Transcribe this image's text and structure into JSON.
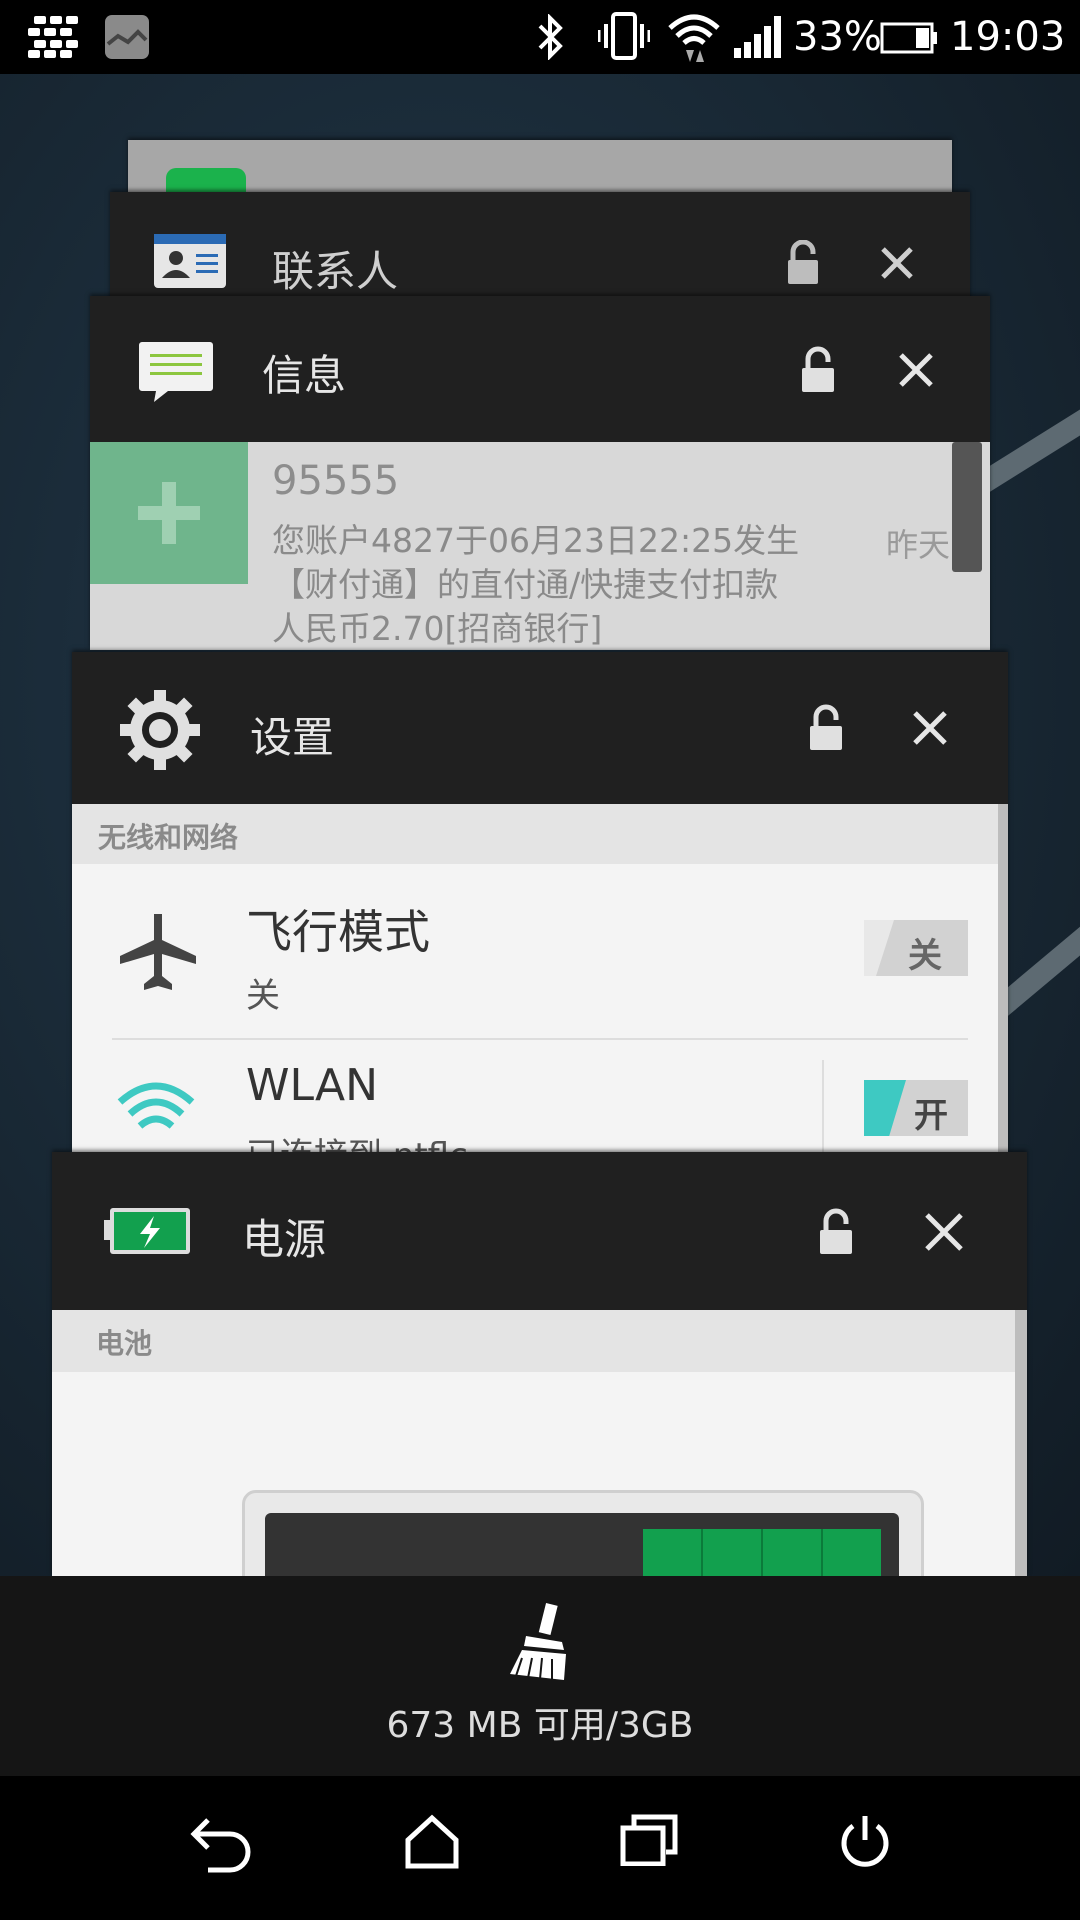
{
  "status_bar": {
    "battery_percent": "33%",
    "time": "19:03",
    "icons": [
      "bbm-icon",
      "gallery-icon",
      "bluetooth-icon",
      "vibrate-icon",
      "wifi-icon",
      "signal-icon",
      "battery-icon"
    ]
  },
  "cards": {
    "top_partial": {
      "label": ""
    },
    "contacts": {
      "title": "联系人"
    },
    "messages": {
      "title": "信息",
      "sender": "95555",
      "body_line1": "您账户4827于06月23日22:25发生",
      "body_line2": "【财付通】的直付通/快捷支付扣款",
      "body_line3": "人民币2.70[招商银行]",
      "time": "昨天"
    },
    "settings": {
      "title": "设置",
      "section": "无线和网络",
      "airplane_title": "飞行模式",
      "airplane_sub": "关",
      "airplane_toggle": "关",
      "wlan_title": "WLAN",
      "wlan_sub": "已连接到 ntflc",
      "wlan_toggle": "开"
    },
    "power": {
      "title": "电源",
      "section": "电池"
    }
  },
  "memory": {
    "text": "673 MB 可用/3GB"
  },
  "colors": {
    "wifi_accent": "#3ec9c2",
    "battery_green": "#12a04e",
    "card_header": "#202020"
  }
}
